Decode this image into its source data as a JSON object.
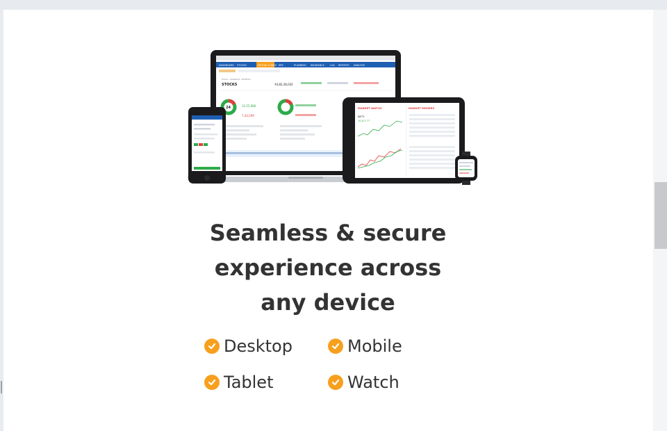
{
  "section": {
    "headline": "Seamless & secure experience across any device",
    "features": [
      {
        "label": "Desktop",
        "icon": "checkmark-icon"
      },
      {
        "label": "Mobile",
        "icon": "checkmark-icon"
      },
      {
        "label": "Tablet",
        "icon": "checkmark-icon"
      },
      {
        "label": "Watch",
        "icon": "checkmark-icon"
      }
    ]
  },
  "devices_illustration": {
    "desktop": {
      "nav_items": [
        "DASHBOARD",
        "STOCKS",
        "MUTUAL FUNDS",
        "NPS",
        "PLANNING",
        "INSURANCE",
        "LOA",
        "REPORTS",
        "ANALYSIS"
      ],
      "breadcrumb": "Home › Snapshot › Portfolio",
      "page_title": "STOCKS",
      "summary_value": "₹4,82,28,032",
      "gain_text": "12,55,986",
      "loss_text": "7,43,599",
      "donut_label": "24"
    },
    "tablet": {
      "left_title": "MARKET WATCH",
      "right_title": "MARKET MOVERS",
      "index_label": "NIFTY",
      "index_value": "10,427.77"
    }
  },
  "colors": {
    "accent_orange": "#f7a01e",
    "text_dark": "#333333",
    "app_nav_blue": "#1f5fb3",
    "gain_green": "#2eaa4a",
    "loss_red": "#e04040"
  }
}
